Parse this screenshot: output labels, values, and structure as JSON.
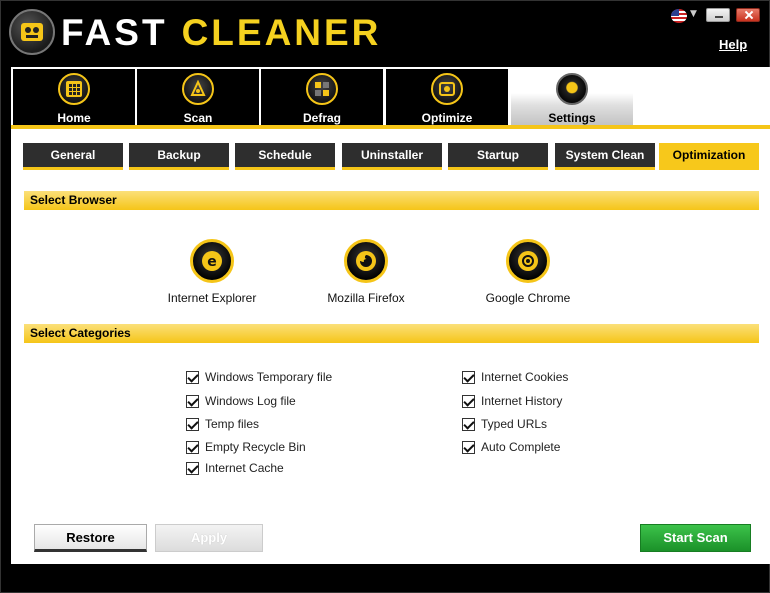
{
  "app": {
    "title_part1": "FAST",
    "title_part2": "CLEANER",
    "help": "Help"
  },
  "main_tabs": [
    {
      "label": "Home",
      "icon": "grid-icon"
    },
    {
      "label": "Scan",
      "icon": "scan-icon"
    },
    {
      "label": "Defrag",
      "icon": "defrag-icon"
    },
    {
      "label": "Optimize",
      "icon": "optimize-icon"
    },
    {
      "label": "Settings",
      "icon": "settings-icon",
      "active": true
    }
  ],
  "sub_tabs": [
    {
      "label": "General"
    },
    {
      "label": "Backup"
    },
    {
      "label": "Schedule"
    },
    {
      "label": "Uninstaller"
    },
    {
      "label": "Startup"
    },
    {
      "label": "System Clean"
    },
    {
      "label": "Optimization",
      "active": true
    }
  ],
  "select_browser": {
    "header": "Select Browser",
    "browsers": [
      {
        "label": "Internet Explorer",
        "icon": "internet-explorer-icon"
      },
      {
        "label": "Mozilla Firefox",
        "icon": "firefox-icon"
      },
      {
        "label": "Google Chrome",
        "icon": "chrome-icon"
      }
    ]
  },
  "select_categories": {
    "header": "Select Categories",
    "left": [
      {
        "label": "Windows Temporary file",
        "checked": true
      },
      {
        "label": "Windows Log file",
        "checked": true
      },
      {
        "label": "Temp files",
        "checked": true
      },
      {
        "label": "Empty Recycle Bin",
        "checked": true
      },
      {
        "label": "Internet Cache",
        "checked": true
      }
    ],
    "right": [
      {
        "label": "Internet Cookies",
        "checked": true
      },
      {
        "label": "Internet History",
        "checked": true
      },
      {
        "label": "Typed URLs",
        "checked": true
      },
      {
        "label": "Auto Complete",
        "checked": true
      }
    ]
  },
  "buttons": {
    "restore": "Restore",
    "apply": "Apply",
    "start_scan": "Start Scan"
  },
  "colors": {
    "accent": "#f5c518",
    "start_scan": "#1b9129"
  }
}
